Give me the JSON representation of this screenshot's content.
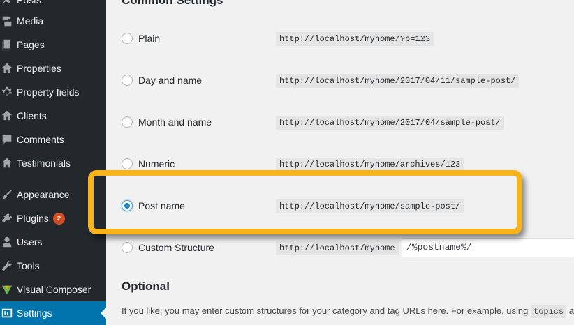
{
  "sidebar": {
    "items": [
      {
        "label": "Posts",
        "icon": "pushpin-icon"
      },
      {
        "label": "Media",
        "icon": "media-icon"
      },
      {
        "label": "Pages",
        "icon": "pages-icon"
      },
      {
        "label": "Properties",
        "icon": "home-icon"
      },
      {
        "label": "Property fields",
        "icon": "gear-icon"
      },
      {
        "label": "Clients",
        "icon": "home-icon"
      },
      {
        "label": "Comments",
        "icon": "comment-icon"
      },
      {
        "label": "Testimonials",
        "icon": "home-icon"
      },
      {
        "label": "Appearance",
        "icon": "paintbrush-icon"
      },
      {
        "label": "Plugins",
        "icon": "plugin-icon",
        "badge": "2"
      },
      {
        "label": "Users",
        "icon": "user-icon"
      },
      {
        "label": "Tools",
        "icon": "wrench-icon"
      },
      {
        "label": "Visual Composer",
        "icon": "visual-composer-icon"
      },
      {
        "label": "Settings",
        "icon": "settings-icon",
        "active": true
      }
    ]
  },
  "main": {
    "section_title": "Common Settings",
    "options": [
      {
        "label": "Plain",
        "url": "http://localhost/myhome/?p=123",
        "checked": false
      },
      {
        "label": "Day and name",
        "url": "http://localhost/myhome/2017/04/11/sample-post/",
        "checked": false
      },
      {
        "label": "Month and name",
        "url": "http://localhost/myhome/2017/04/sample-post/",
        "checked": false
      },
      {
        "label": "Numeric",
        "url": "http://localhost/myhome/archives/123",
        "checked": false
      },
      {
        "label": "Post name",
        "url": "http://localhost/myhome/sample-post/",
        "checked": true
      },
      {
        "label": "Custom Structure",
        "url": "http://localhost/myhome",
        "checked": false
      }
    ],
    "custom_structure_value": "/%postname%/",
    "optional_title": "Optional",
    "optional_text": "If you like, you may enter custom structures for your category and tag URLs here. For example, using",
    "optional_code": "topics",
    "optional_tail": "as",
    "highlight_color": "#f8b31b",
    "accent_color": "#0073aa"
  }
}
